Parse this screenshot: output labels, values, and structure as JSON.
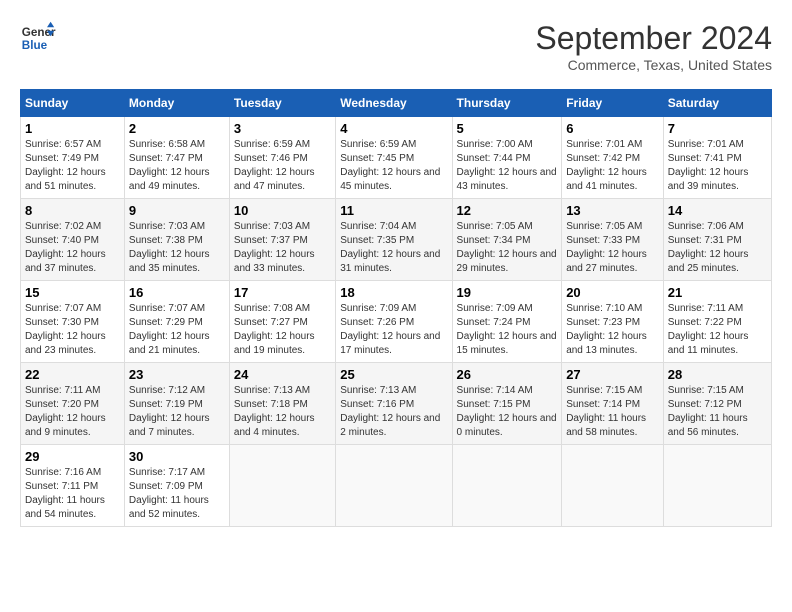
{
  "logo": {
    "line1": "General",
    "line2": "Blue"
  },
  "title": "September 2024",
  "subtitle": "Commerce, Texas, United States",
  "headers": [
    "Sunday",
    "Monday",
    "Tuesday",
    "Wednesday",
    "Thursday",
    "Friday",
    "Saturday"
  ],
  "weeks": [
    [
      {
        "day": "1",
        "sunrise": "6:57 AM",
        "sunset": "7:49 PM",
        "daylight": "12 hours and 51 minutes."
      },
      {
        "day": "2",
        "sunrise": "6:58 AM",
        "sunset": "7:47 PM",
        "daylight": "12 hours and 49 minutes."
      },
      {
        "day": "3",
        "sunrise": "6:59 AM",
        "sunset": "7:46 PM",
        "daylight": "12 hours and 47 minutes."
      },
      {
        "day": "4",
        "sunrise": "6:59 AM",
        "sunset": "7:45 PM",
        "daylight": "12 hours and 45 minutes."
      },
      {
        "day": "5",
        "sunrise": "7:00 AM",
        "sunset": "7:44 PM",
        "daylight": "12 hours and 43 minutes."
      },
      {
        "day": "6",
        "sunrise": "7:01 AM",
        "sunset": "7:42 PM",
        "daylight": "12 hours and 41 minutes."
      },
      {
        "day": "7",
        "sunrise": "7:01 AM",
        "sunset": "7:41 PM",
        "daylight": "12 hours and 39 minutes."
      }
    ],
    [
      {
        "day": "8",
        "sunrise": "7:02 AM",
        "sunset": "7:40 PM",
        "daylight": "12 hours and 37 minutes."
      },
      {
        "day": "9",
        "sunrise": "7:03 AM",
        "sunset": "7:38 PM",
        "daylight": "12 hours and 35 minutes."
      },
      {
        "day": "10",
        "sunrise": "7:03 AM",
        "sunset": "7:37 PM",
        "daylight": "12 hours and 33 minutes."
      },
      {
        "day": "11",
        "sunrise": "7:04 AM",
        "sunset": "7:35 PM",
        "daylight": "12 hours and 31 minutes."
      },
      {
        "day": "12",
        "sunrise": "7:05 AM",
        "sunset": "7:34 PM",
        "daylight": "12 hours and 29 minutes."
      },
      {
        "day": "13",
        "sunrise": "7:05 AM",
        "sunset": "7:33 PM",
        "daylight": "12 hours and 27 minutes."
      },
      {
        "day": "14",
        "sunrise": "7:06 AM",
        "sunset": "7:31 PM",
        "daylight": "12 hours and 25 minutes."
      }
    ],
    [
      {
        "day": "15",
        "sunrise": "7:07 AM",
        "sunset": "7:30 PM",
        "daylight": "12 hours and 23 minutes."
      },
      {
        "day": "16",
        "sunrise": "7:07 AM",
        "sunset": "7:29 PM",
        "daylight": "12 hours and 21 minutes."
      },
      {
        "day": "17",
        "sunrise": "7:08 AM",
        "sunset": "7:27 PM",
        "daylight": "12 hours and 19 minutes."
      },
      {
        "day": "18",
        "sunrise": "7:09 AM",
        "sunset": "7:26 PM",
        "daylight": "12 hours and 17 minutes."
      },
      {
        "day": "19",
        "sunrise": "7:09 AM",
        "sunset": "7:24 PM",
        "daylight": "12 hours and 15 minutes."
      },
      {
        "day": "20",
        "sunrise": "7:10 AM",
        "sunset": "7:23 PM",
        "daylight": "12 hours and 13 minutes."
      },
      {
        "day": "21",
        "sunrise": "7:11 AM",
        "sunset": "7:22 PM",
        "daylight": "12 hours and 11 minutes."
      }
    ],
    [
      {
        "day": "22",
        "sunrise": "7:11 AM",
        "sunset": "7:20 PM",
        "daylight": "12 hours and 9 minutes."
      },
      {
        "day": "23",
        "sunrise": "7:12 AM",
        "sunset": "7:19 PM",
        "daylight": "12 hours and 7 minutes."
      },
      {
        "day": "24",
        "sunrise": "7:13 AM",
        "sunset": "7:18 PM",
        "daylight": "12 hours and 4 minutes."
      },
      {
        "day": "25",
        "sunrise": "7:13 AM",
        "sunset": "7:16 PM",
        "daylight": "12 hours and 2 minutes."
      },
      {
        "day": "26",
        "sunrise": "7:14 AM",
        "sunset": "7:15 PM",
        "daylight": "12 hours and 0 minutes."
      },
      {
        "day": "27",
        "sunrise": "7:15 AM",
        "sunset": "7:14 PM",
        "daylight": "11 hours and 58 minutes."
      },
      {
        "day": "28",
        "sunrise": "7:15 AM",
        "sunset": "7:12 PM",
        "daylight": "11 hours and 56 minutes."
      }
    ],
    [
      {
        "day": "29",
        "sunrise": "7:16 AM",
        "sunset": "7:11 PM",
        "daylight": "11 hours and 54 minutes."
      },
      {
        "day": "30",
        "sunrise": "7:17 AM",
        "sunset": "7:09 PM",
        "daylight": "11 hours and 52 minutes."
      },
      null,
      null,
      null,
      null,
      null
    ]
  ]
}
